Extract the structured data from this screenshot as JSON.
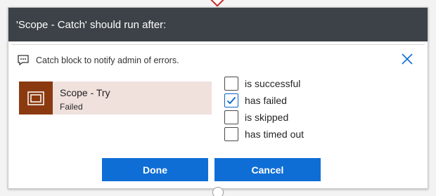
{
  "dialog": {
    "title": "'Scope - Catch' should run after:",
    "description": "Catch block to notify admin of errors."
  },
  "action": {
    "name": "Scope - Try",
    "status": "Failed",
    "icon": "scope-icon"
  },
  "conditions": [
    {
      "label": "is successful",
      "checked": false
    },
    {
      "label": "has failed",
      "checked": true
    },
    {
      "label": "is skipped",
      "checked": false
    },
    {
      "label": "has timed out",
      "checked": false
    }
  ],
  "buttons": {
    "done_label": "Done",
    "cancel_label": "Cancel"
  },
  "colors": {
    "header_bg": "#3c4247",
    "accent": "#0f6ed6",
    "action_icon_bg": "#8b3a0f",
    "action_card_bg": "#f0e1dd"
  }
}
